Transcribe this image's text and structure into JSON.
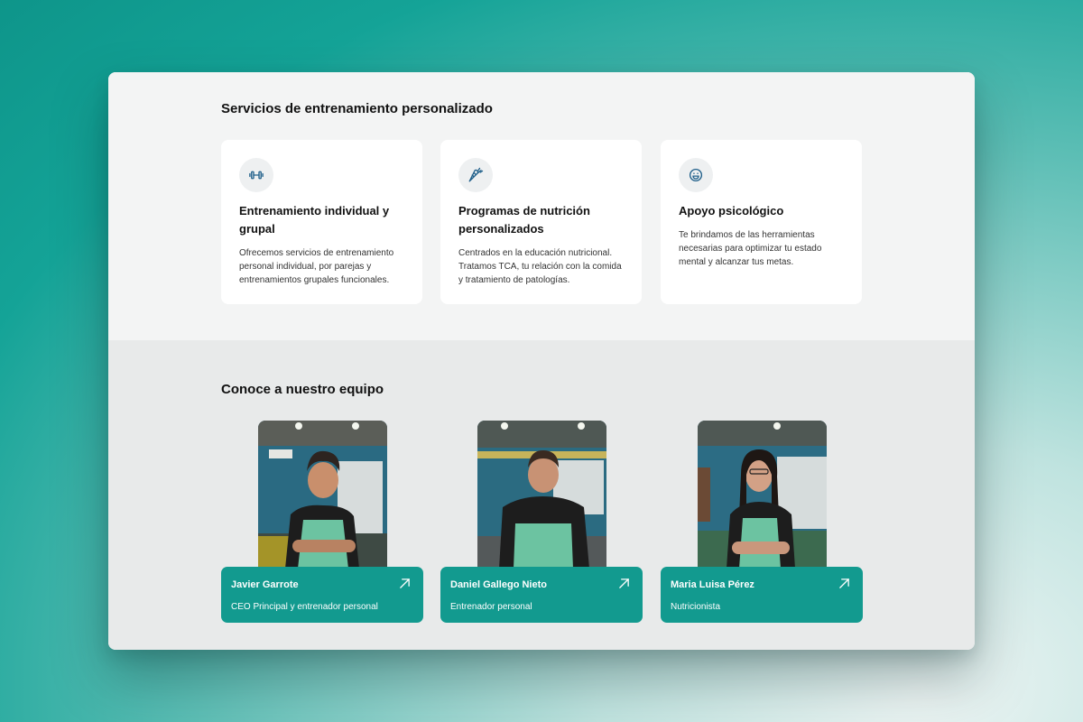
{
  "services": {
    "title": "Servicios de entrenamiento personalizado",
    "cards": [
      {
        "icon": "dumbbell-icon",
        "title": "Entrenamiento individual y grupal",
        "description": "Ofrecemos servicios de entrenamiento personal individual, por parejas y entrenamientos grupales funcionales."
      },
      {
        "icon": "carrot-icon",
        "title": "Programas de nutrición personalizados",
        "description": "Centrados en la educación nutricional. Tratamos TCA, tu relación con la comida y tratamiento de patologías."
      },
      {
        "icon": "smile-icon",
        "title": "Apoyo psicológico",
        "description": "Te brindamos de las herramientas necesarias para optimizar tu estado mental y alcanzar tus metas."
      }
    ]
  },
  "team": {
    "title": "Conoce a nuestro equipo",
    "members": [
      {
        "name": "Javier Garrote",
        "role": "CEO Principal y entrenador personal"
      },
      {
        "name": "Daniel Gallego Nieto",
        "role": "Entrenador personal"
      },
      {
        "name": "Maria Luisa Pérez",
        "role": "Nutricionista"
      }
    ]
  },
  "colors": {
    "accent": "#129a8f",
    "icon": "#1f5f8a",
    "icon_bg": "#eef0f1"
  }
}
